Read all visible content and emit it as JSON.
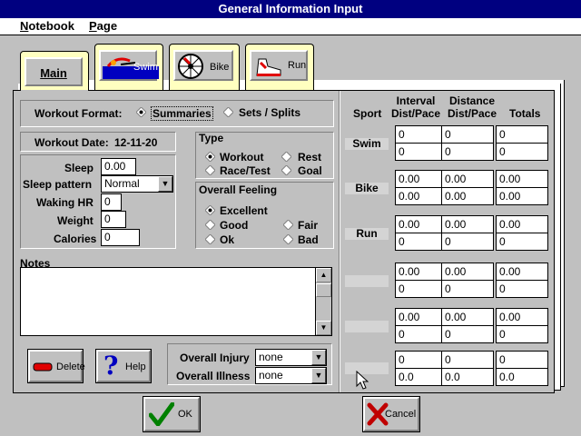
{
  "window": {
    "title": "General Information Input"
  },
  "menu": [
    {
      "label": "Notebook",
      "key": "N",
      "rest": "otebook"
    },
    {
      "label": "Page",
      "key": "P",
      "rest": "age"
    }
  ],
  "tabs": {
    "main": "Main",
    "swim": "Swim",
    "bike": "Bike",
    "run": "Run"
  },
  "workout_format": {
    "label": "Workout Format:",
    "options": [
      "Summaries",
      "Sets / Splits"
    ],
    "selected": "Summaries"
  },
  "workout_date": {
    "label": "Workout Date:",
    "value": "12-11-20"
  },
  "personal": {
    "sleep": {
      "label": "Sleep",
      "value": "0.00"
    },
    "sleep_pattern": {
      "label": "Sleep pattern",
      "value": "Normal"
    },
    "waking_hr": {
      "label": "Waking HR",
      "value": "0"
    },
    "weight": {
      "label": "Weight",
      "value": "0"
    },
    "calories": {
      "label": "Calories",
      "value": "0"
    }
  },
  "type": {
    "label": "Type",
    "options": [
      "Workout",
      "Rest",
      "Race/Test",
      "Goal"
    ],
    "selected": "Workout"
  },
  "feeling": {
    "label": "Overall Feeling",
    "options": [
      "Excellent",
      "Good",
      "Fair",
      "Ok",
      "Bad"
    ],
    "selected": "Excellent"
  },
  "notes": {
    "label": "Notes",
    "value": ""
  },
  "buttons": {
    "delete": "Delete",
    "help": "Help",
    "ok": "OK",
    "cancel": "Cancel"
  },
  "injury": {
    "label": "Overall Injury",
    "value": "none"
  },
  "illness": {
    "label": "Overall Illness",
    "value": "none"
  },
  "grid": {
    "headers": {
      "sport": "Sport",
      "interval": "Interval Dist/Pace",
      "distance": "Distance Dist/Pace",
      "totals": "Totals"
    },
    "rows": [
      {
        "sport": "Swim",
        "dist": [
          "0",
          "0",
          "0"
        ],
        "pace": [
          "0",
          "0",
          "0"
        ]
      },
      {
        "sport": "Bike",
        "dist": [
          "0.00",
          "0.00",
          "0.00"
        ],
        "pace": [
          "0.00",
          "0.00",
          "0.00"
        ]
      },
      {
        "sport": "Run",
        "dist": [
          "0.00",
          "0.00",
          "0.00"
        ],
        "pace": [
          "0",
          "0",
          "0"
        ]
      },
      {
        "sport": "",
        "dist": [
          "0.00",
          "0.00",
          "0.00"
        ],
        "pace": [
          "0",
          "0",
          "0"
        ]
      },
      {
        "sport": "",
        "dist": [
          "0.00",
          "0.00",
          "0.00"
        ],
        "pace": [
          "0",
          "0",
          "0"
        ]
      },
      {
        "sport": "",
        "dist": [
          "0",
          "0",
          "0"
        ],
        "pace": [
          "0.0",
          "0.0",
          "0.0"
        ]
      }
    ]
  }
}
